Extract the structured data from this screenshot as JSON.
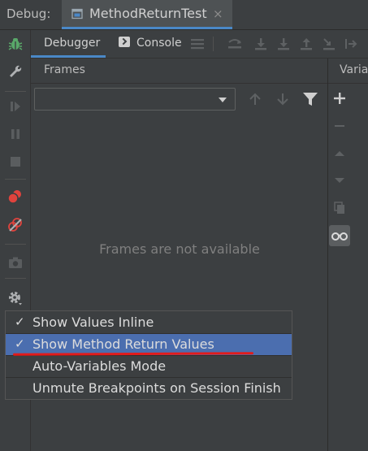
{
  "topbar": {
    "label": "Debug:",
    "run_tab": {
      "label": "MethodReturnTest",
      "close": "×"
    }
  },
  "subtabs": {
    "debugger": "Debugger",
    "console": "Console"
  },
  "frames": {
    "title": "Frames",
    "empty_text": "Frames are not available"
  },
  "variables": {
    "title": "Variab"
  },
  "menu": {
    "items": [
      {
        "label": "Show Values Inline",
        "checked": "✓"
      },
      {
        "label": "Show Method Return Values",
        "checked": "✓"
      },
      {
        "label": "Auto-Variables Mode",
        "checked": ""
      },
      {
        "label": "Unmute Breakpoints on Session Finish",
        "checked": ""
      }
    ],
    "selected_index": 1
  },
  "colors": {
    "accent": "#4a88c7",
    "selection": "#4b6eaf",
    "annotation": "#e21b1b",
    "bug": "#59a869",
    "breakpoint": "#e0433d"
  }
}
